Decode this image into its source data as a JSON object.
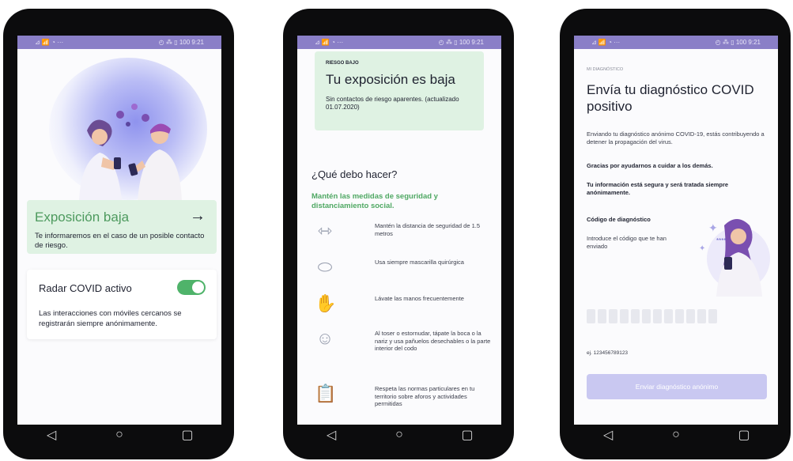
{
  "phones": [
    {
      "status": {
        "left": "⊿ 📶 ◔ ···",
        "right": "◴ ⁂ ▯ 100 9:21"
      },
      "card": {
        "title": "Exposición baja",
        "arrow": "→",
        "description": "Te informaremos en el caso de un posible contacto de riesgo."
      },
      "radar": {
        "title": "Radar COVID activo",
        "enabled": true,
        "description": "Las interacciones con móviles cercanos se registrarán siempre anónimamente."
      }
    },
    {
      "status": {
        "left": "⊿ 📶 ◔ ···",
        "right": "◴ ⁂ ▯ 100 9:21"
      },
      "card": {
        "eyebrow": "RIESGO BAJO",
        "title": "Tu exposición es baja",
        "description": "Sin contactos de riesgo aparentes. (actualizado 01.07.2020)"
      },
      "heading": "¿Qué debo hacer?",
      "subheading": "Mantén las medidas de seguridad y distanciamiento social.",
      "tips": [
        {
          "icon": "distance-icon",
          "glyph": "⇿",
          "text": "Mantén la distancia de seguridad de 1.5 metros"
        },
        {
          "icon": "mask-icon",
          "glyph": "⬭",
          "text": "Usa siempre mascarilla quirúrgica"
        },
        {
          "icon": "handwash-icon",
          "glyph": "✋",
          "text": "Lávate las manos frecuentemente"
        },
        {
          "icon": "cough-icon",
          "glyph": "☺",
          "text": "Al toser o estornudar, tápate la boca o la nariz y usa pañuelos desechables o la parte interior del codo"
        },
        {
          "icon": "clipboard-icon",
          "glyph": "📋",
          "text": "Respeta las normas particulares en tu territorio sobre aforos y actividades permitidas"
        }
      ]
    },
    {
      "status": {
        "left": "⊿ 📶 ◔ ···",
        "right": "◴ ⁂ ▯ 100 9:21"
      },
      "eyebrow": "MI DIAGNÓSTICO",
      "title": "Envía tu diagnóstico COVID positivo",
      "intro": "Enviando tu diagnóstico anónimo COVID-19, estás contribuyendo a detener la propagación del virus.",
      "thanks": "Gracias por ayudarnos a cuidar a los demás.",
      "privacy": "Tu información está segura y será tratada siempre anónimamente.",
      "code_label": "Código de diagnóstico",
      "code_hint": "Introduce el código que te han enviado",
      "code_example": "ej. 123456789123",
      "send_button": "Enviar diagnóstico anónimo"
    }
  ],
  "nav": {
    "back": "◁",
    "home": "○",
    "recents": "▢"
  }
}
